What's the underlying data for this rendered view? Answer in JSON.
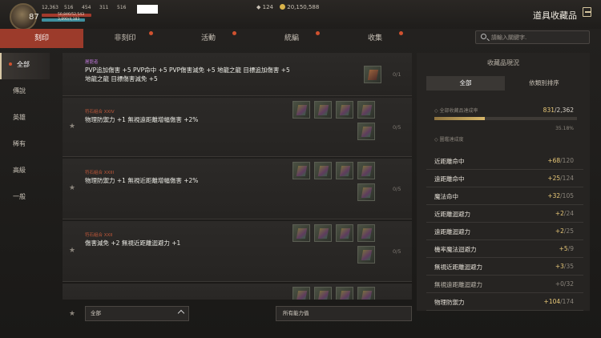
{
  "player": {
    "level": "87",
    "stats": [
      "12,363",
      "516",
      "454",
      "311",
      "516"
    ],
    "hp_text": "50,846/52,543",
    "mp_text": "3,890/4,183"
  },
  "currency": {
    "diamonds": "124",
    "gold": "20,150,588"
  },
  "window_title": "道具收藏品",
  "tabs": [
    {
      "label": "刻印",
      "active": true,
      "dot": false
    },
    {
      "label": "非刻印",
      "active": false,
      "dot": true
    },
    {
      "label": "活動",
      "active": false,
      "dot": true
    },
    {
      "label": "統編",
      "active": false,
      "dot": true
    },
    {
      "label": "收集",
      "active": false,
      "dot": true
    }
  ],
  "search": {
    "placeholder": "請輸入關鍵字."
  },
  "left_nav": [
    "全部",
    "傳說",
    "英雄",
    "稀有",
    "高級",
    "一般"
  ],
  "items": [
    {
      "category": "屠龍者",
      "category_color": "purple",
      "desc": "PVP追加傷害 +5 PVP命中 +5 PVP傷害減免 +5 地龍之龍 目標追加傷害 +5 地龍之龍 目標傷害減免 +5",
      "count": "0/1"
    },
    {
      "category": "符石組合 XXIV",
      "category_color": "red",
      "desc": "物理防禦力 +1 無視遠距離增幅傷害 +2%",
      "count": "0/5"
    },
    {
      "category": "符石組合 XXIII",
      "category_color": "red",
      "desc": "物理防禦力 +1 無視近距離增幅傷害 +2%",
      "count": "0/5"
    },
    {
      "category": "符石組合 XXII",
      "category_color": "red",
      "desc": "傷害減免 +2 無視近距離迴避力 +1",
      "count": "0/5"
    }
  ],
  "filters": {
    "grade": "全部",
    "ability": "所有能力值"
  },
  "panel": {
    "title": "收藏品現況",
    "tabs": [
      "全部",
      "依類別排序"
    ],
    "overall_label": "全部收藏品達成率",
    "overall_current": "831",
    "overall_total": "/2,362",
    "overall_fraction": 0.3518,
    "percent": "35.18%",
    "section_label": "圖鑑達成度",
    "stats": [
      {
        "name": "近距離命中",
        "current": "+68",
        "max": "/120",
        "dim": false
      },
      {
        "name": "遠距離命中",
        "current": "+25",
        "max": "/124",
        "dim": false
      },
      {
        "name": "魔法命中",
        "current": "+32",
        "max": "/105",
        "dim": false
      },
      {
        "name": "近距離迴避力",
        "current": "+2",
        "max": "/24",
        "dim": false
      },
      {
        "name": "遠距離迴避力",
        "current": "+2",
        "max": "/25",
        "dim": false
      },
      {
        "name": "機率魔法迴避力",
        "current": "+5",
        "max": "/9",
        "dim": false
      },
      {
        "name": "無視近距離迴避力",
        "current": "+3",
        "max": "/35",
        "dim": false
      },
      {
        "name": "無視遠距離迴避力",
        "current": "+0",
        "max": "/32",
        "dim": true
      },
      {
        "name": "物理防禦力",
        "current": "+104",
        "max": "/174",
        "dim": false
      }
    ]
  }
}
